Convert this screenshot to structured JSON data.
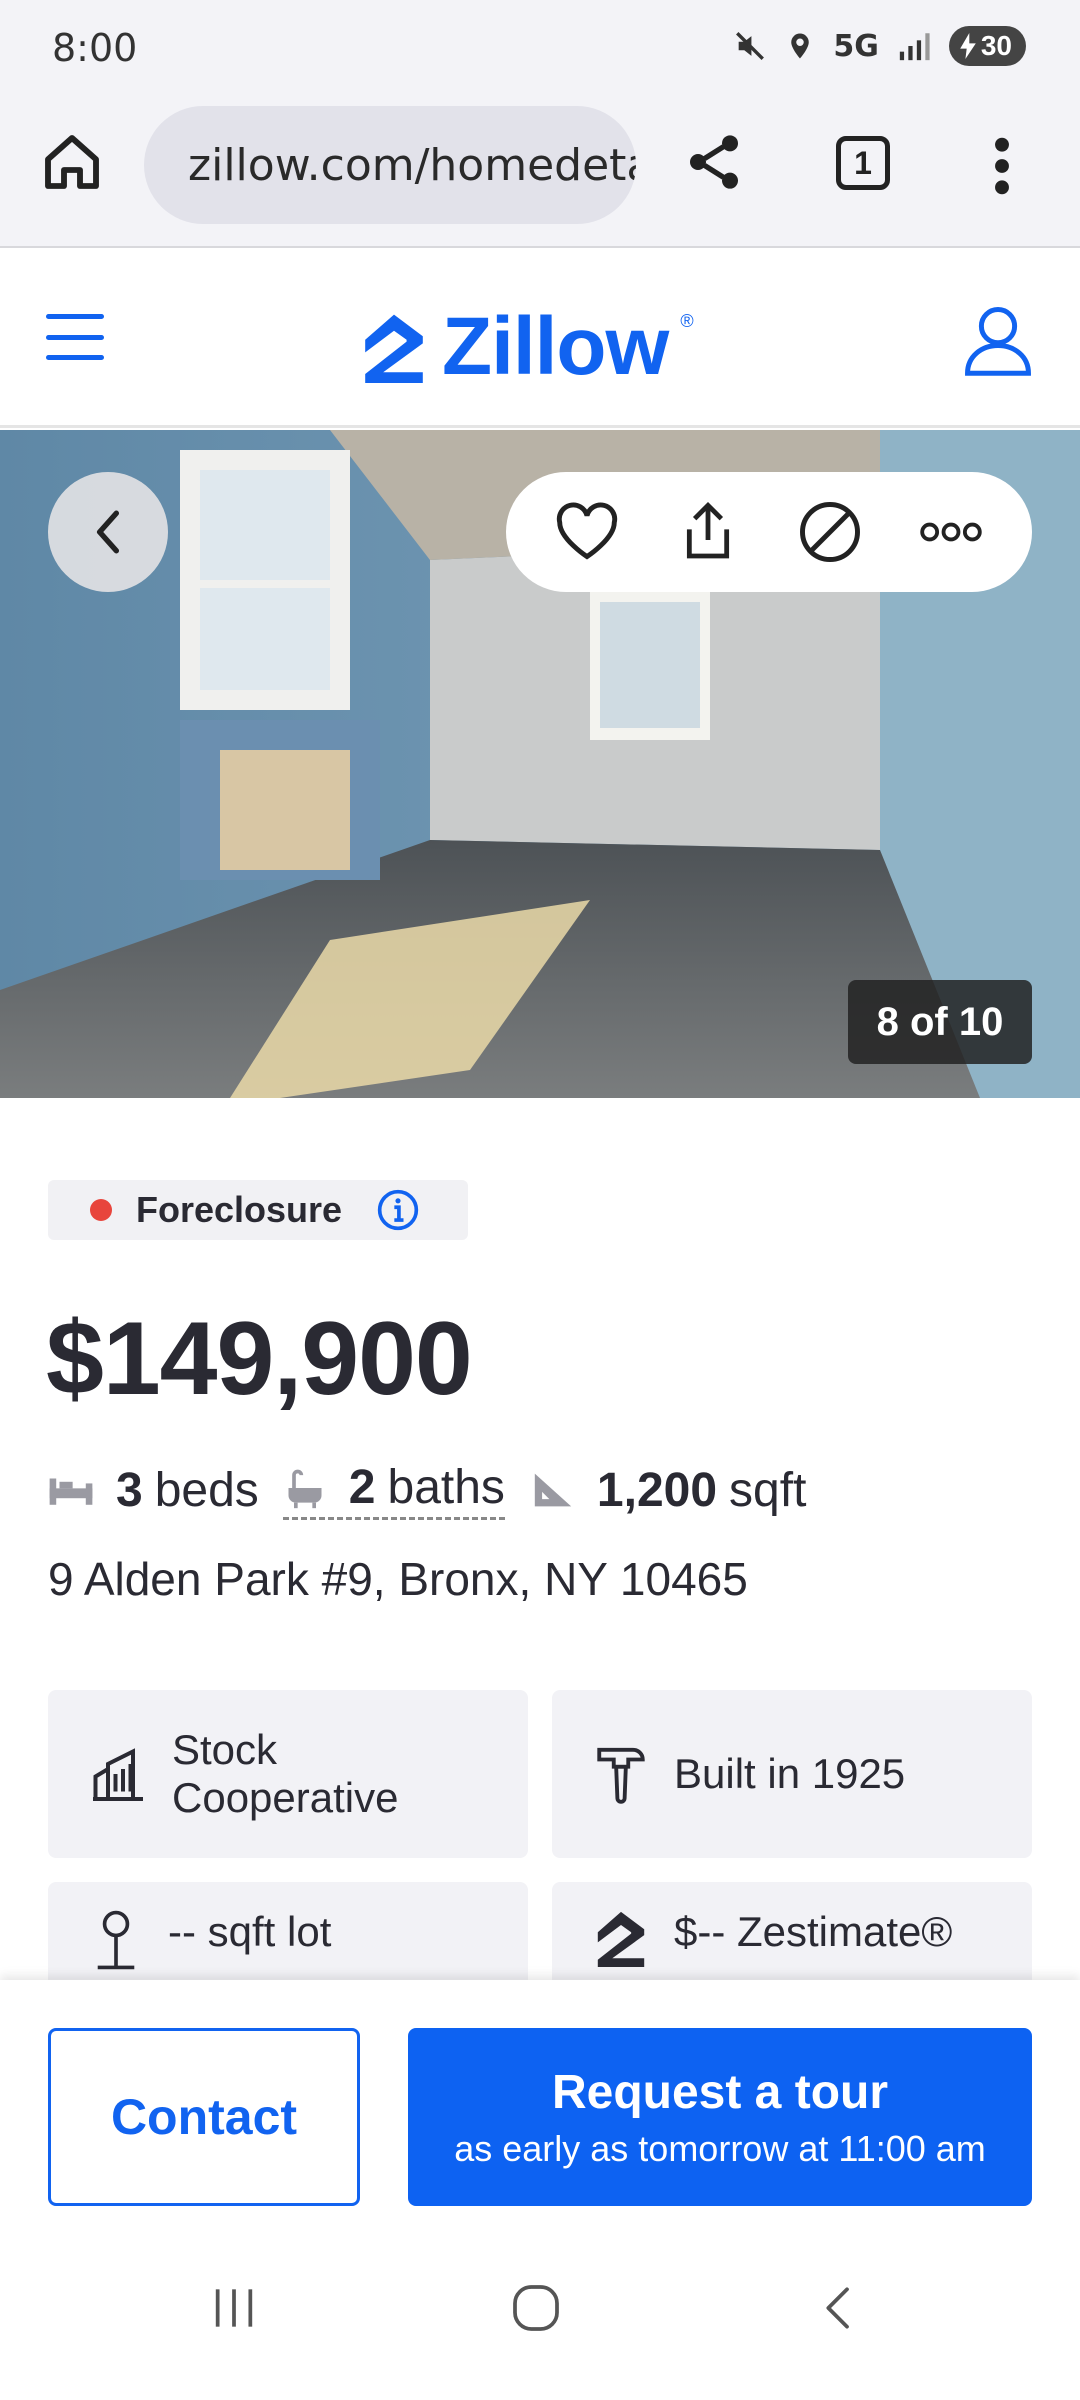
{
  "status_bar": {
    "time": "8:00",
    "network": "5G",
    "battery": "30"
  },
  "browser": {
    "url": "zillow.com/homedetails",
    "tab_count": "1"
  },
  "header": {
    "logo_text": "Zillow",
    "logo_mark": "®",
    "brand_color": "#1163f0"
  },
  "gallery": {
    "counter": "8 of 10"
  },
  "listing": {
    "status_label": "Foreclosure",
    "status_color": "#e8453c",
    "price": "$149,900",
    "beds_value": "3",
    "beds_unit": "beds",
    "baths_value": "2",
    "baths_unit": "baths",
    "sqft_value": "1,200",
    "sqft_unit": "sqft",
    "address": "9 Alden Park #9, Bronx, NY 10465"
  },
  "facts_cards": [
    {
      "icon": "building-icon",
      "label": "Stock Cooperative"
    },
    {
      "icon": "hammer-icon",
      "label": "Built in 1925"
    },
    {
      "icon": "tree-icon",
      "label": "-- sqft lot"
    },
    {
      "icon": "zestimate-icon",
      "label": "$-- Zestimate®"
    }
  ],
  "actions": {
    "contact_label": "Contact",
    "tour_label": "Request a tour",
    "tour_sub": "as early as tomorrow at 11:00 am"
  }
}
